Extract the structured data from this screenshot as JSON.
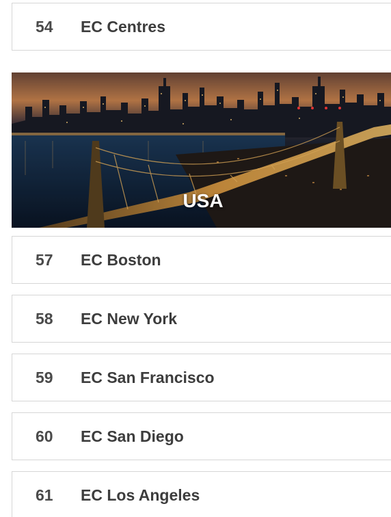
{
  "top_item": {
    "number": "54",
    "label": "EC Centres"
  },
  "banner": {
    "title": "USA"
  },
  "items": [
    {
      "number": "57",
      "label": "EC Boston"
    },
    {
      "number": "58",
      "label": "EC New York"
    },
    {
      "number": "59",
      "label": "EC San Francisco"
    },
    {
      "number": "60",
      "label": "EC San Diego"
    },
    {
      "number": "61",
      "label": "EC Los Angeles"
    }
  ],
  "colors": {
    "border": "#d6d6d6",
    "text": "#3d3d3d",
    "number": "#4a4a4a",
    "banner_title": "#ffffff"
  }
}
